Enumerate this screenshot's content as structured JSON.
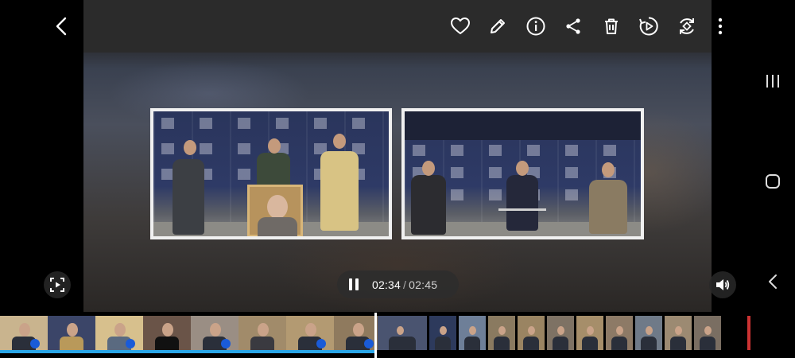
{
  "player": {
    "current_time": "02:34",
    "separator": "/",
    "duration": "02:45",
    "progress_fraction": 0.933
  },
  "toolbar": {
    "icons": [
      "back-icon",
      "heart-icon",
      "pencil-icon",
      "info-icon",
      "share-icon",
      "trash-icon",
      "play-circle-icon",
      "rotate-icon",
      "more-vert-icon"
    ]
  },
  "colors": {
    "background": "#000000",
    "accent": "#2aa6e8",
    "frame_border": "#f0f0f0"
  },
  "filmstrip": {
    "main_thumbnails": 8,
    "small_thumbnails": 12
  }
}
